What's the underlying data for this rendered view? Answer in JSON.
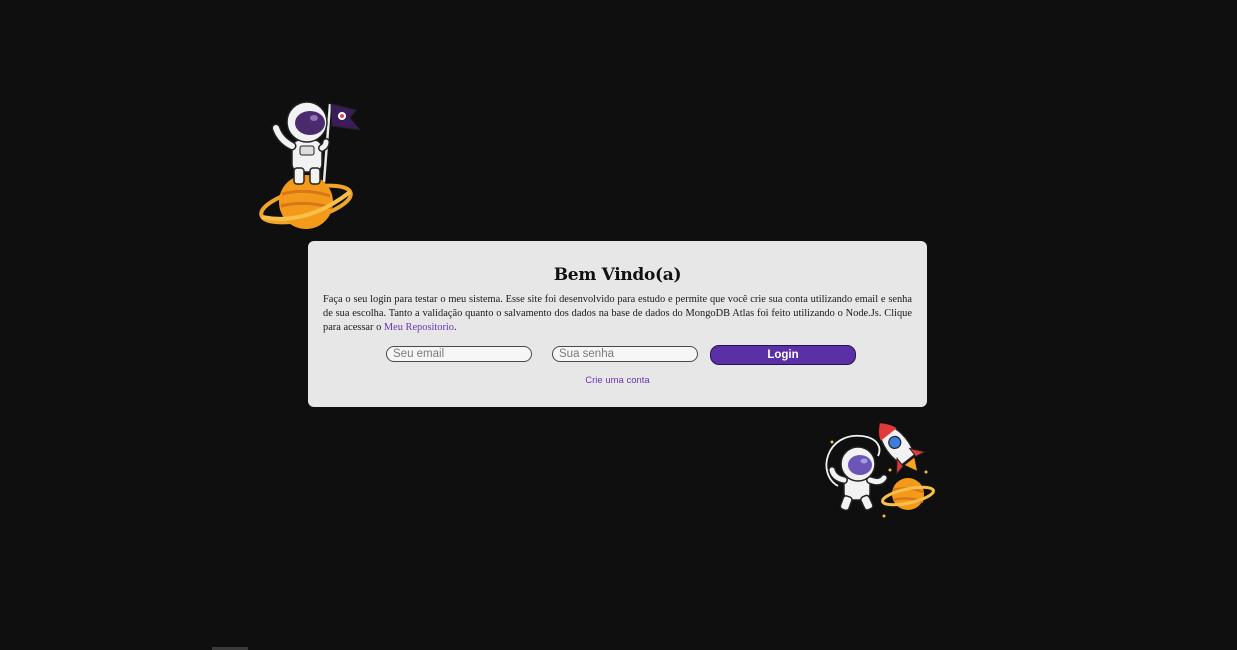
{
  "card": {
    "title": "Bem Vindo(a)",
    "description_before_link": "Faça o seu login para testar o meu sistema. Esse site foi desenvolvido para estudo e permite que você crie sua conta utilizando email e senha de sua escolha. Tanto a validação quanto o salvamento dos dados na base de dados do MongoDB Atlas foi feito utilizando o Node.Js. Clique para acessar o",
    "repo_link_label": "Meu Repositorio",
    "description_after_link": "."
  },
  "form": {
    "email_placeholder": "Seu email",
    "email_value": "",
    "password_placeholder": "Sua senha",
    "password_value": "",
    "login_label": "Login",
    "create_account_label": "Crie uma conta"
  },
  "illustrations": {
    "top_left": "astronaut-on-planet-with-flag-icon",
    "bottom_right": "astronaut-with-rocket-and-planet-icon"
  },
  "colors": {
    "background": "#0f0f0f",
    "card": "#e7e7e7",
    "accent": "#5b2fa5",
    "link": "#6a35b0"
  }
}
